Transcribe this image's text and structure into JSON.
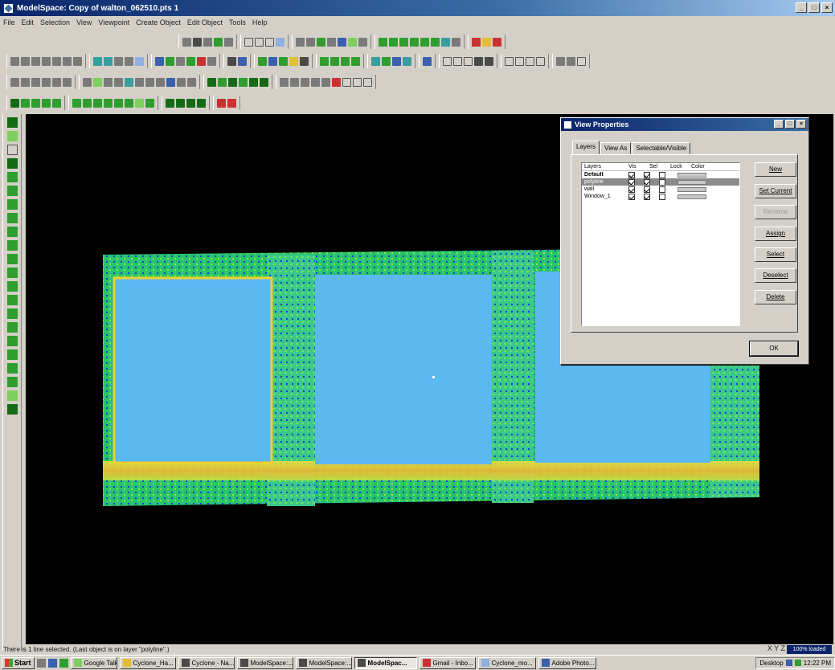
{
  "window": {
    "title": "ModelSpace: Copy of walton_062510.pts 1"
  },
  "menu": [
    "File",
    "Edit",
    "Selection",
    "View",
    "Viewpoint",
    "Create Object",
    "Edit Object",
    "Tools",
    "Help"
  ],
  "dialog": {
    "title": "View Properties",
    "tabs": [
      "Layers",
      "View As",
      "Selectable/Visible"
    ],
    "layer_headers": [
      "Layers",
      "Vis",
      "Sel",
      "Lock",
      "Color"
    ],
    "layers": [
      {
        "name": "Default",
        "vis": true,
        "sel": true,
        "lock": false
      },
      {
        "name": "polyline",
        "vis": true,
        "sel": true,
        "lock": false
      },
      {
        "name": "wall",
        "vis": true,
        "sel": true,
        "lock": false
      },
      {
        "name": "Window_1",
        "vis": true,
        "sel": true,
        "lock": false
      }
    ],
    "buttons": [
      "New",
      "Set Current",
      "Rename",
      "Assign",
      "Select",
      "Deselect",
      "Delete"
    ],
    "ok_label": "OK"
  },
  "status": {
    "message": "There is 1 line selected. (Last object is on layer \"polyline\".)",
    "axes": "X Y Z",
    "progress_label": "100% loaded"
  },
  "taskbar": {
    "start_label": "Start",
    "tasks": [
      {
        "label": "Google Talk",
        "active": false
      },
      {
        "label": "Cyclone_Ha...",
        "active": false
      },
      {
        "label": "Cyclone - Na...",
        "active": false
      },
      {
        "label": "ModelSpace:...",
        "active": false
      },
      {
        "label": "ModelSpace:...",
        "active": false
      },
      {
        "label": "ModelSpac...",
        "active": true
      },
      {
        "label": "Gmail - Inbo...",
        "active": false
      },
      {
        "label": "Cyclone_mo...",
        "active": false
      },
      {
        "label": "Adobe Photo...",
        "active": false
      }
    ],
    "tray_desktop": "Desktop",
    "clock": "12:22 PM"
  },
  "colors": {
    "titlebar": "#0a246a",
    "viewport_bg": "#000000",
    "window_fill": "#5bb8f0",
    "selection_outline": "#f2d12c"
  }
}
